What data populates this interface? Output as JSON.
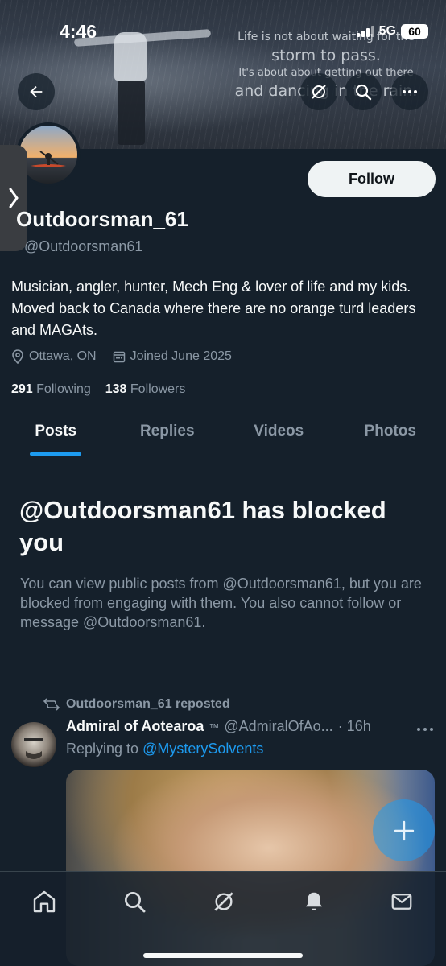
{
  "status_bar": {
    "time": "4:46",
    "network": "5G",
    "battery": "60"
  },
  "banner": {
    "quote_line1": "Life is not about waiting for the",
    "quote_line2": "storm to pass.",
    "quote_line3": "It's about about getting out there",
    "quote_line4": "and dancing in the rain."
  },
  "profile": {
    "follow_label": "Follow",
    "display_name": "Outdoorsman_61",
    "handle": "@Outdoorsman61",
    "bio": "Musician, angler, hunter, Mech Eng & lover of life and my kids. Moved back to Canada where there are no orange turd leaders and MAGAts.",
    "location": "Ottawa, ON",
    "joined": "Joined June 2025",
    "following_count": "291",
    "following_label": "Following",
    "followers_count": "138",
    "followers_label": "Followers"
  },
  "tabs": [
    {
      "label": "Posts",
      "active": true
    },
    {
      "label": "Replies",
      "active": false
    },
    {
      "label": "Videos",
      "active": false
    },
    {
      "label": "Photos",
      "active": false
    }
  ],
  "blocked": {
    "title": "@Outdoorsman61 has blocked you",
    "description": "You can view public posts from @Outdoorsman61, but you are blocked from engaging with them. You also cannot follow or message @Outdoorsman61."
  },
  "post": {
    "repost_label": "Outdoorsman_61 reposted",
    "author": "Admiral of Aotearoa",
    "author_suffix": "™",
    "author_handle": "@AdmiralOfAo...",
    "time": "· 16h",
    "replying_prefix": "Replying to",
    "replying_to": "@MysterySolvents"
  },
  "colors": {
    "background": "#15202b",
    "accent": "#1d9bf0",
    "secondary_text": "#8b98a5",
    "divider": "#38444d"
  },
  "icons": {
    "back": "arrow-left-icon",
    "grok": "grok-icon",
    "search": "search-icon",
    "more": "more-horizontal-icon",
    "location": "location-pin-icon",
    "calendar": "calendar-icon",
    "repost": "repost-icon",
    "compose": "plus-icon",
    "nav": [
      "home-icon",
      "search-icon",
      "grok-icon",
      "bell-icon",
      "mail-icon"
    ]
  }
}
